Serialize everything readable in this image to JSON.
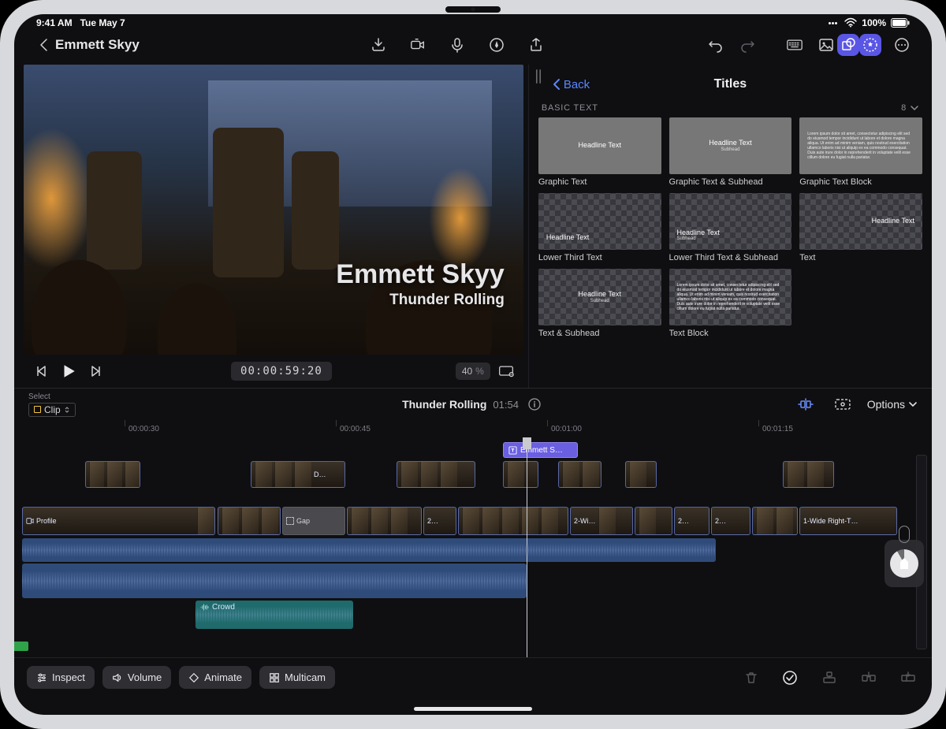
{
  "status": {
    "time": "9:41 AM",
    "date": "Tue May 7",
    "battery": "100%"
  },
  "nav": {
    "project_title": "Emmett Skyy"
  },
  "viewer": {
    "overlay_title": "Emmett Skyy",
    "overlay_subtitle": "Thunder Rolling",
    "timecode": "00:00:59:20",
    "zoom_value": "40",
    "zoom_unit": "%"
  },
  "browser": {
    "back_label": "Back",
    "title": "Titles",
    "section_label": "BASIC TEXT",
    "section_count": "8",
    "tiles": [
      {
        "label": "Graphic Text"
      },
      {
        "label": "Graphic Text & Subhead"
      },
      {
        "label": "Graphic Text Block"
      },
      {
        "label": "Lower Third Text"
      },
      {
        "label": "Lower Third Text & Subhead"
      },
      {
        "label": "Text"
      },
      {
        "label": "Text & Subhead"
      },
      {
        "label": "Text Block"
      }
    ],
    "sample_headline": "Headline Text",
    "sample_subhead": "Subhead",
    "sample_block": "Lorem ipsum dolor sit amet, consectetur adipiscing elit sed do eiusmod tempor incididunt ut labore et dolore magna aliqua. Ut enim ad minim veniam, quis nostrud exercitation ullamco laboris nisi ut aliquip ex ea commodo consequat. Duis aute irure dolor in reprehenderit in voluptate velit esse cillum dolore eu fugiat nulla pariatur."
  },
  "timeline": {
    "select_label": "Select",
    "mode_label": "Clip",
    "project_name": "Thunder Rolling",
    "project_duration": "01:54",
    "options_label": "Options",
    "ruler": [
      "00:00:30",
      "00:00:45",
      "00:01:00",
      "00:01:15"
    ],
    "title_clip_label": "Emmett S…",
    "video_secondary_label": "D…",
    "primary_clips": [
      "Profile",
      "Gap",
      "2…",
      "2-Wi…",
      "2…",
      "2…",
      "1-Wide Right-T…"
    ],
    "audio_clip_label": "Crowd"
  },
  "bottombar": {
    "inspect": "Inspect",
    "volume": "Volume",
    "animate": "Animate",
    "multicam": "Multicam"
  }
}
